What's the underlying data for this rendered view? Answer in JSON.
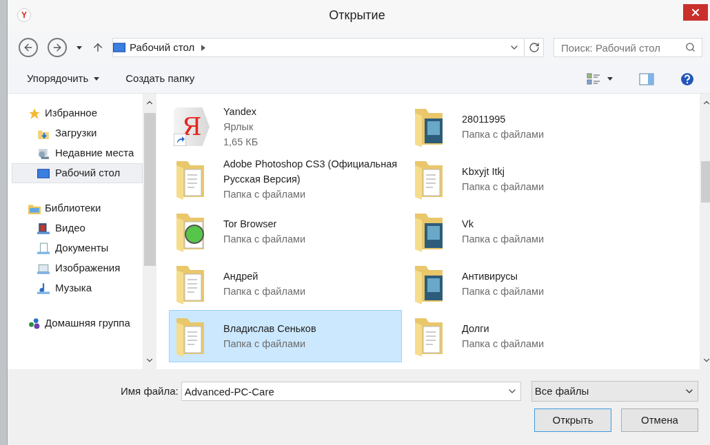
{
  "window": {
    "title": "Открытие",
    "app_icon": "Y"
  },
  "nav": {
    "location": "Рабочий стол",
    "search": {
      "placeholder": "Поиск: Рабочий стол"
    }
  },
  "toolbar": {
    "organize": "Упорядочить",
    "new_folder": "Создать папку"
  },
  "sidebar": {
    "groups": [
      {
        "label": "Избранное",
        "kind": "star",
        "children": [
          {
            "label": "Загрузки",
            "kind": "downloads",
            "selected": false
          },
          {
            "label": "Недавние места",
            "kind": "recent",
            "selected": false
          },
          {
            "label": "Рабочий стол",
            "kind": "desktop",
            "selected": true
          }
        ]
      },
      {
        "label": "Библиотеки",
        "kind": "libraries",
        "children": [
          {
            "label": "Видео",
            "kind": "video",
            "selected": false
          },
          {
            "label": "Документы",
            "kind": "documents",
            "selected": false
          },
          {
            "label": "Изображения",
            "kind": "pictures",
            "selected": false
          },
          {
            "label": "Музыка",
            "kind": "music",
            "selected": false
          }
        ]
      },
      {
        "label": "Домашняя группа",
        "kind": "homegroup"
      }
    ]
  },
  "files": [
    {
      "name": "Yandex",
      "lines": [
        "Ярлык",
        "1,65 КБ"
      ],
      "kind": "shortcut",
      "logo": "Я",
      "selected": false
    },
    {
      "name": "28011995",
      "lines": [
        "Папка с файлами"
      ],
      "kind": "folder-photos",
      "selected": false
    },
    {
      "name": "Adobe Photoshop CS3 (Официальная Русская Версия)",
      "lines": [
        "Папка с файлами"
      ],
      "kind": "folder-docs",
      "selected": false
    },
    {
      "name": "Kbxyjt Itkj",
      "lines": [
        "Папка с файлами"
      ],
      "kind": "folder-docs",
      "selected": false
    },
    {
      "name": "Tor Browser",
      "lines": [
        "Папка с файлами"
      ],
      "kind": "folder-globe",
      "selected": false
    },
    {
      "name": "Vk",
      "lines": [
        "Папка с файлами"
      ],
      "kind": "folder-photos",
      "selected": false
    },
    {
      "name": "Андрей",
      "lines": [
        "Папка с файлами"
      ],
      "kind": "folder-docs",
      "selected": false
    },
    {
      "name": "Антивирусы",
      "lines": [
        "Папка с файлами"
      ],
      "kind": "folder-photos",
      "selected": false
    },
    {
      "name": "Владислав Сеньков",
      "lines": [
        "Папка с файлами"
      ],
      "kind": "folder-docs",
      "selected": true
    },
    {
      "name": "Долги",
      "lines": [
        "Папка с файлами"
      ],
      "kind": "folder-docs",
      "selected": false
    }
  ],
  "footer": {
    "filename_label": "Имя файла:",
    "filename": "Advanced-PC-Care",
    "filter": "Все файлы",
    "buttons": [
      {
        "label": "Открыть",
        "default": true
      },
      {
        "label": "Отмена",
        "default": false
      }
    ]
  }
}
